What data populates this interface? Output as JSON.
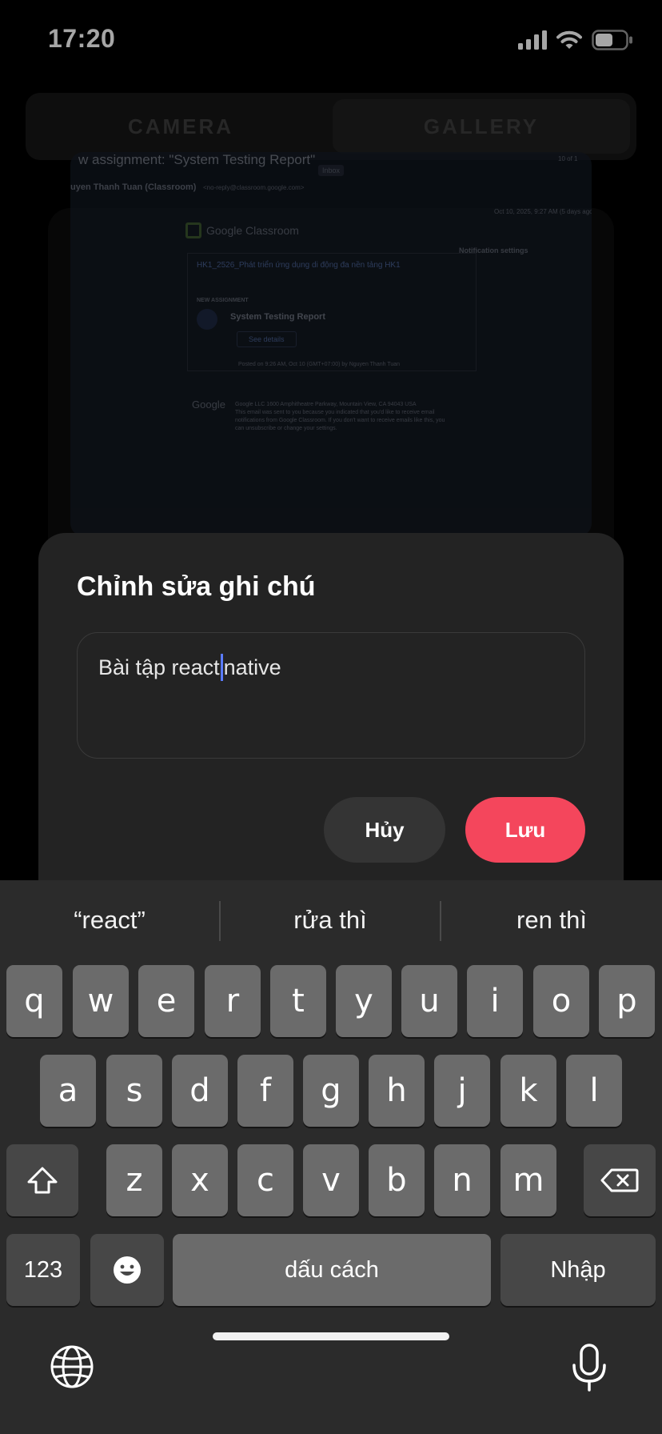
{
  "status_bar": {
    "time": "17:20"
  },
  "tabs": [
    {
      "label": "CAMERA"
    },
    {
      "label": "GALLERY"
    }
  ],
  "photo_doc": {
    "subject": "w assignment: \"System Testing Report\"",
    "inbox_tag": "Inbox",
    "sender": "uyen Thanh Tuan (Classroom)",
    "sender_email": "<no-reply@classroom.google.com>",
    "date": "Oct 10, 2025, 9:27 AM (5 days ago)",
    "page_count": "10 of 1",
    "brand": "Google Classroom",
    "notif_settings": "Notification settings",
    "course": "HK1_2526_Phát triển ứng dụng di động đa nền tảng HK1",
    "new_label": "NEW ASSIGNMENT",
    "assignment": "System Testing Report",
    "see_details": "See details",
    "posted": "Posted on 9:26 AM, Oct 10 (GMT+07:00) by Nguyen Thanh Tuan",
    "footer_brand": "Google",
    "footer_1": "Google LLC 1600 Amphitheatre Parkway, Mountain View, CA 94043 USA",
    "footer_2": "This email was sent to you because you indicated that you'd like to receive email",
    "footer_3": "notifications from Google Classroom. If you don't want to receive emails like this, you",
    "footer_4": "can unsubscribe or change your settings."
  },
  "sheet": {
    "title": "Chỉnh sửa ghi chú",
    "note_before_caret": "Bài tập react",
    "note_after_caret": "native",
    "cancel_label": "Hủy",
    "save_label": "Lưu",
    "accent_color": "#f4465c"
  },
  "keyboard": {
    "suggestions": [
      "“react”",
      "rửa thì",
      "ren thì"
    ],
    "row1": [
      "q",
      "w",
      "e",
      "r",
      "t",
      "y",
      "u",
      "i",
      "o",
      "p"
    ],
    "row2": [
      "a",
      "s",
      "d",
      "f",
      "g",
      "h",
      "j",
      "k",
      "l"
    ],
    "row3": [
      "z",
      "x",
      "c",
      "v",
      "b",
      "n",
      "m"
    ],
    "numbers_label": "123",
    "space_label": "dấu cách",
    "return_label": "Nhập",
    "icons": [
      "shift-icon",
      "delete-icon",
      "emoji-icon",
      "globe-icon",
      "mic-icon"
    ]
  }
}
